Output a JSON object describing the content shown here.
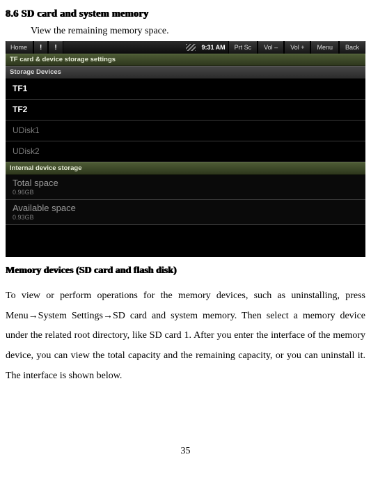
{
  "section_number": "8.6",
  "section_title": "SD card and system memory",
  "intro_line": "View the remaining memory space.",
  "statusbar": {
    "home": "Home",
    "time": "9:31 AM",
    "buttons": {
      "prtsc": "Prt Sc",
      "voldn": "Vol –",
      "volup": "Vol +",
      "menu": "Menu",
      "back": "Back"
    }
  },
  "sectionbars": {
    "settings_title": "TF card & device storage settings",
    "storage_devices": "Storage Devices",
    "internal_storage": "Internal device storage"
  },
  "devices": {
    "tf1": {
      "label": "TF1",
      "enabled": true
    },
    "tf2": {
      "label": "TF2",
      "enabled": true
    },
    "udisk1": {
      "label": "UDisk1",
      "enabled": false
    },
    "udisk2": {
      "label": "UDisk2",
      "enabled": false
    }
  },
  "storage": {
    "total": {
      "label": "Total space",
      "value": "0.96GB"
    },
    "available": {
      "label": "Available space",
      "value": "0.93GB"
    }
  },
  "subheading": "Memory devices (SD card and flash disk)",
  "paragraph": "To view or perform operations for the memory devices, such as uninstalling, press Menu→System Settings→SD card and system memory. Then select a memory device under the related root directory, like SD card 1. After you enter the interface of the memory device, you can view the total capacity and the remaining capacity, or you can uninstall it. The interface is shown below.",
  "page_number": "35"
}
